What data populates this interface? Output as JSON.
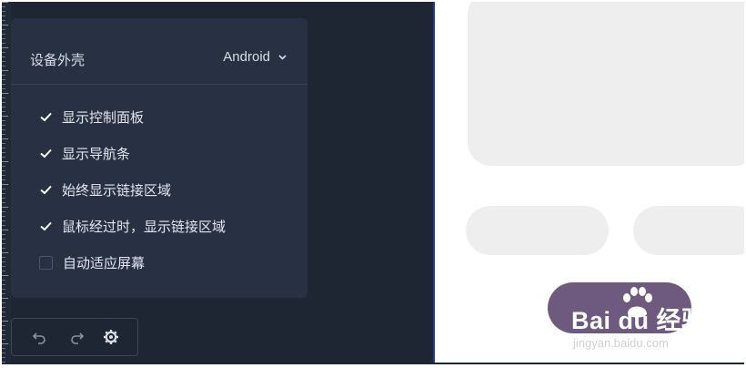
{
  "settings": {
    "device_label": "设备外壳",
    "device_value": "Android",
    "options": [
      {
        "label": "显示控制面板",
        "checked": true
      },
      {
        "label": "显示导航条",
        "checked": true
      },
      {
        "label": "始终显示链接区域",
        "checked": true
      },
      {
        "label": "鼠标经过时，显示链接区域",
        "checked": true
      },
      {
        "label": "自动适应屏幕",
        "checked": false
      }
    ]
  },
  "toolbar": {
    "undo_icon": "undo-icon",
    "redo_icon": "redo-icon",
    "settings_icon": "gear-icon"
  },
  "watermark": {
    "brand": "Bai du 经验",
    "url": "jingyan.baidu.com"
  },
  "colors": {
    "panel_bg": "#283143",
    "sidebar_bg": "#1f2633",
    "text": "#e3e6ec",
    "placeholder": "#eeeeee",
    "watermark": "#6e5a7e"
  }
}
